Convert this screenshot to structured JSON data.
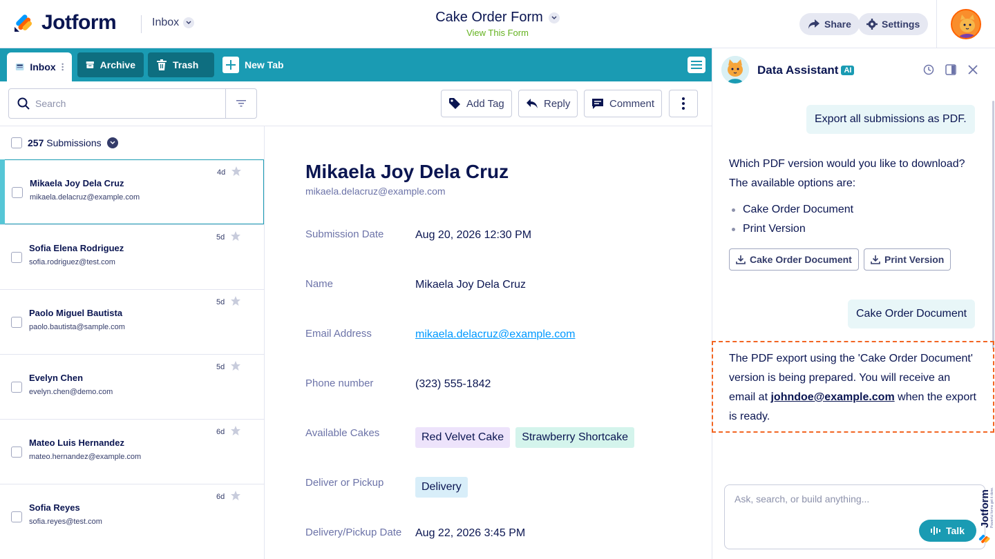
{
  "header": {
    "brand": "Jotform",
    "inbox_select": "Inbox",
    "form_title": "Cake Order Form",
    "view_form_link": "View This Form",
    "share_label": "Share",
    "settings_label": "Settings"
  },
  "tabs": {
    "inbox": "Inbox",
    "archive": "Archive",
    "trash": "Trash",
    "new_tab": "New Tab"
  },
  "toolbar": {
    "search_placeholder": "Search",
    "add_tag": "Add Tag",
    "reply": "Reply",
    "comment": "Comment"
  },
  "list": {
    "count": "257",
    "count_label": "Submissions",
    "items": [
      {
        "name": "Mikaela Joy Dela Cruz",
        "email": "mikaela.delacruz@example.com",
        "age": "4d"
      },
      {
        "name": "Sofia Elena Rodriguez",
        "email": "sofia.rodriguez@test.com",
        "age": "5d"
      },
      {
        "name": "Paolo Miguel Bautista",
        "email": "paolo.bautista@sample.com",
        "age": "5d"
      },
      {
        "name": "Evelyn Chen",
        "email": "evelyn.chen@demo.com",
        "age": "5d"
      },
      {
        "name": "Mateo Luis Hernandez",
        "email": "mateo.hernandez@example.com",
        "age": "6d"
      },
      {
        "name": "Sofia Reyes",
        "email": "sofia.reyes@test.com",
        "age": "6d"
      }
    ]
  },
  "detail": {
    "name": "Mikaela Joy Dela Cruz",
    "email": "mikaela.delacruz@example.com",
    "fields": {
      "submission_date_label": "Submission Date",
      "submission_date": "Aug 20, 2026 12:30 PM",
      "name_label": "Name",
      "name": "Mikaela Joy Dela Cruz",
      "email_label": "Email Address",
      "email": "mikaela.delacruz@example.com",
      "phone_label": "Phone number",
      "phone": "(323) 555-1842",
      "cakes_label": "Available Cakes",
      "cakes": [
        "Red Velvet Cake",
        "Strawberry Shortcake"
      ],
      "delivery_label": "Deliver or Pickup",
      "delivery": "Delivery",
      "delivery_date_label": "Delivery/Pickup Date",
      "delivery_date": "Aug 22, 2026 3:45 PM"
    },
    "chip_colors": {
      "red_velvet": "#ede3fb",
      "strawberry": "#d4f4ec",
      "delivery": "#d8eef9"
    }
  },
  "assistant": {
    "title": "Data Assistant",
    "badge": "AI",
    "user_msg_1": "Export all submissions as PDF.",
    "bot_msg_1": "Which PDF version would you like to download? The available options are:",
    "options": [
      "Cake Order Document",
      "Print Version"
    ],
    "btn_cake_doc": "Cake Order Document",
    "btn_print": "Print Version",
    "user_msg_2": "Cake Order Document",
    "bot_msg_2_pre": "The PDF export using the 'Cake Order Document' version is being prepared. You will receive an email at",
    "bot_msg_2_email": "johndoe@example.com",
    "bot_msg_2_post": "when the export is ready.",
    "input_placeholder": "Ask, search, or build anything...",
    "talk_label": "Talk",
    "side_brand": "Jotform",
    "side_tagline": "Powerful forms get it done."
  },
  "colors": {
    "accent": "#1a9bb3",
    "accent_dark": "#0e6e80",
    "highlight": "#f26522",
    "link": "#0099ff",
    "view_form": "#64b21f"
  }
}
